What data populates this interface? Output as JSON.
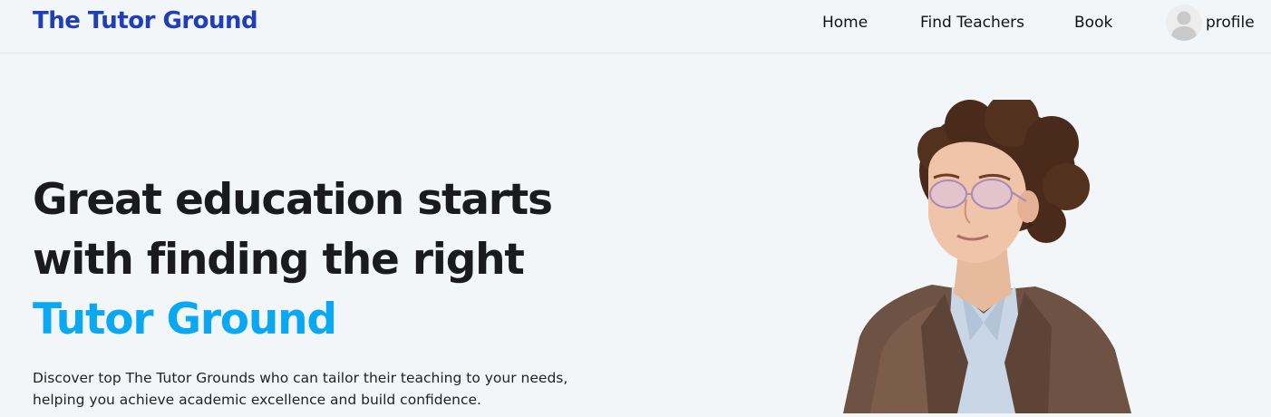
{
  "header": {
    "brand": "The Tutor Ground",
    "nav": {
      "home": "Home",
      "find_teachers": "Find Teachers",
      "book": "Book"
    },
    "profile_label": "profile"
  },
  "hero": {
    "heading_line1": "Great education starts",
    "heading_line2": "with finding the right",
    "heading_accent": "Tutor Ground",
    "subtitle_line1": "Discover top The Tutor Grounds who can tailor their teaching to your needs,",
    "subtitle_line2": "helping you achieve academic excellence and build confidence."
  },
  "colors": {
    "brand": "#1f3fb8",
    "accent": "#0aa8f2",
    "background": "#f3f6f9"
  },
  "icons": {
    "avatar": "user-avatar-icon",
    "hero": "tutor-photo"
  }
}
